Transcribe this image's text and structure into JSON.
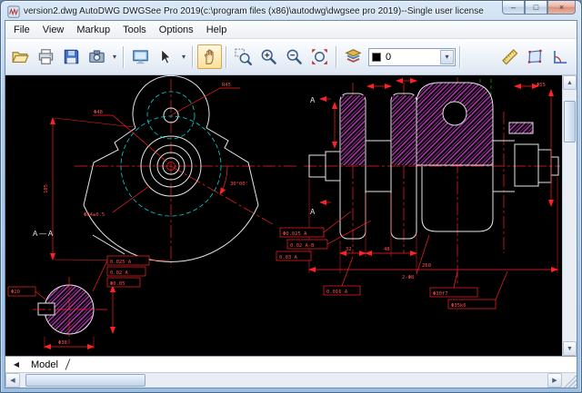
{
  "window": {
    "title": "version2.dwg AutoDWG DWGSee Pro 2019(c:\\program files (x86)\\autodwg\\dwgsee pro 2019)--Single user license",
    "controls": {
      "minimize": "–",
      "maximize": "□",
      "close": "×"
    }
  },
  "menu": {
    "items": [
      "File",
      "View",
      "Markup",
      "Tools",
      "Options",
      "Help"
    ]
  },
  "toolbar": {
    "icons": [
      "open",
      "print",
      "save",
      "capture",
      "fullscreen",
      "select-arrow",
      "pan",
      "zoom-window",
      "zoom-in",
      "zoom-out",
      "zoom-extents",
      "layers",
      "layer-combo",
      "measure-distance",
      "measure-area",
      "measure-angle"
    ],
    "layer_value": "0",
    "dropdown_glyph": "▾"
  },
  "tabs": {
    "model": "Model",
    "nav_left": "◀"
  },
  "scrollbar": {
    "up": "▲",
    "down": "▼",
    "left": "◀",
    "right": "▶"
  },
  "drawing": {
    "labels": {
      "section": "A — A",
      "cut_top": "A",
      "cut_bottom": "A"
    },
    "dims": {
      "phi48": "Φ48",
      "phi84": "Φ84±0.5",
      "r45": "R45",
      "angle": "30°00'",
      "phi38": "Φ38",
      "holes": "2-Φ8",
      "len105": "105",
      "len32": "32",
      "len48": "48",
      "len260": "260",
      "phi55": "Φ55",
      "phi20": "Φ20",
      "fcf1": "Φ0.025 A",
      "fcf2": "0.02 A-B",
      "fcf3": "0.03 A",
      "fcf4": "0.016 A",
      "fcf5": "0.025 A",
      "fcf6": "0.02 A",
      "fcf7": "Φ0.05",
      "fit1": "Φ30f7",
      "fit2": "Φ35k6"
    },
    "colors": {
      "background": "#000000",
      "geometry": "#e6e6e6",
      "dimensions": "#ff2222",
      "hidden": "#00d8d8",
      "hatch": "#c23cc2",
      "auxiliary": "#00bb00"
    }
  }
}
